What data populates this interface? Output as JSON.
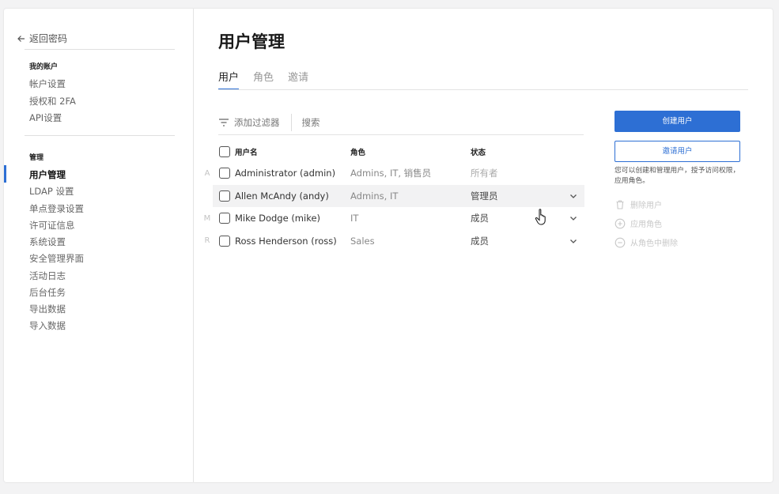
{
  "sidebar": {
    "back_label": "返回密码",
    "my_account_title": "我的账户",
    "account_items": [
      "帐户设置",
      "授权和 2FA",
      "API设置"
    ],
    "manage_title": "管理",
    "manage_items": [
      "用户管理",
      "LDAP 设置",
      "单点登录设置",
      "许可证信息",
      "系统设置",
      "安全管理界面",
      "活动日志",
      "后台任务",
      "导出数据",
      "导入数据"
    ]
  },
  "main": {
    "title": "用户管理",
    "tabs": [
      "用户",
      "角色",
      "邀请"
    ],
    "filter_label": "添加过滤器",
    "search_placeholder": "搜索",
    "table": {
      "headers": {
        "name": "用户名",
        "role": "角色",
        "status": "状态"
      },
      "rows": [
        {
          "letter": "A",
          "name": "Administrator (admin)",
          "role": "Admins, IT, 销售员",
          "status": "所有者"
        },
        {
          "letter": "",
          "name": "Allen McAndy (andy)",
          "role": "Admins, IT",
          "status": "管理员"
        },
        {
          "letter": "M",
          "name": "Mike Dodge (mike)",
          "role": "IT",
          "status": "成员"
        },
        {
          "letter": "R",
          "name": "Ross Henderson (ross)",
          "role": "Sales",
          "status": "成员"
        }
      ]
    }
  },
  "panel": {
    "create_label": "创建用户",
    "invite_label": "邀请用户",
    "help_text": "您可以创建和管理用户，授予访问权限，应用角色。",
    "actions": [
      "删除用户",
      "应用角色",
      "从角色中删除"
    ]
  },
  "colors": {
    "accent": "#2d6fd4"
  },
  "icons": {
    "back": "arrow-left-icon",
    "filter": "filter-icon",
    "chevron": "chevron-down-icon",
    "cursor": "hand-pointer-icon",
    "delete": "trash-icon",
    "apply": "plus-circle-icon",
    "remove": "minus-circle-icon"
  }
}
